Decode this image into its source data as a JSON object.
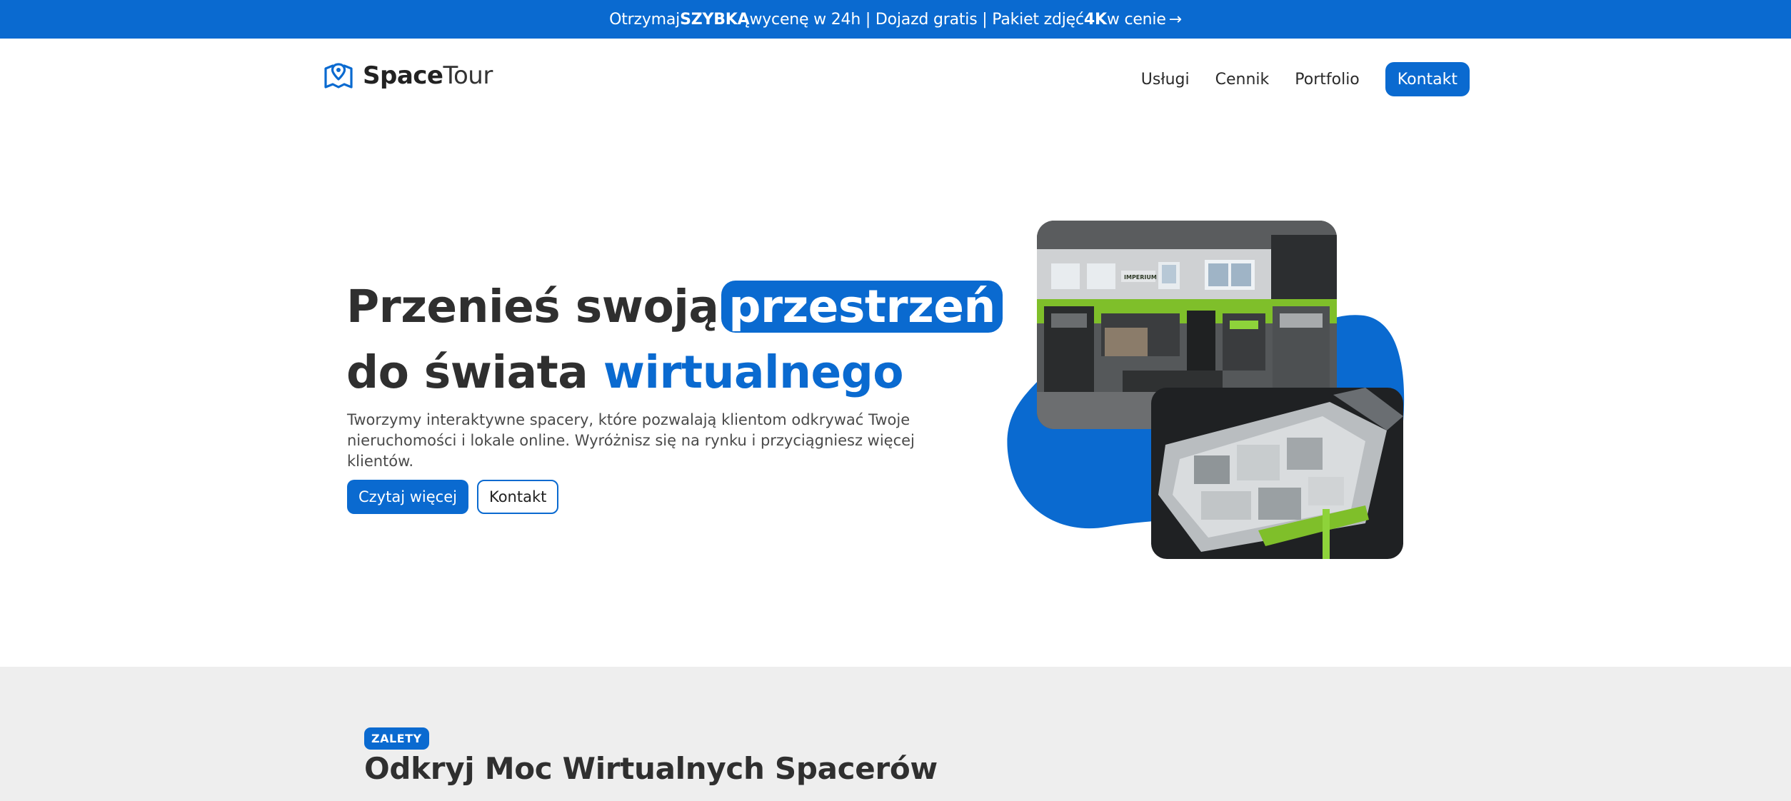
{
  "announcement": {
    "part1": "Otrzymaj ",
    "bold1": "SZYBKĄ",
    "part2": " wycenę w 24h | Dojazd gratis | Pakiet zdjęć ",
    "bold2": "4K",
    "part3": " w cenie",
    "arrow": "→"
  },
  "logo": {
    "icon": "map-pin-icon",
    "brand_bold": "Space",
    "brand_light": "Tour"
  },
  "nav": {
    "items": [
      {
        "label": "Usługi"
      },
      {
        "label": "Cennik"
      },
      {
        "label": "Portfolio"
      }
    ],
    "cta": "Kontakt"
  },
  "hero": {
    "title_line1": "Przenieś swoją",
    "title_highlight": "przestrzeń",
    "title_line2_a": "do świata ",
    "title_line2_b": "wirtualnego",
    "description": "Tworzymy interaktywne spacery, które pozwalają klientom odkrywać Twoje nieruchomości i lokale online. Wyróżnisz się na rynku i przyciągniesz więcej klientów.",
    "btn_primary": "Czytaj więcej",
    "btn_secondary": "Kontakt",
    "gym_sign": "IMPERIUM"
  },
  "features": {
    "badge": "ZALETY",
    "title": "Odkryj Moc Wirtualnych Spacerów"
  },
  "colors": {
    "accent": "#0a6ad0",
    "section_bg": "#eeeeee",
    "text": "#2f2f2f"
  }
}
